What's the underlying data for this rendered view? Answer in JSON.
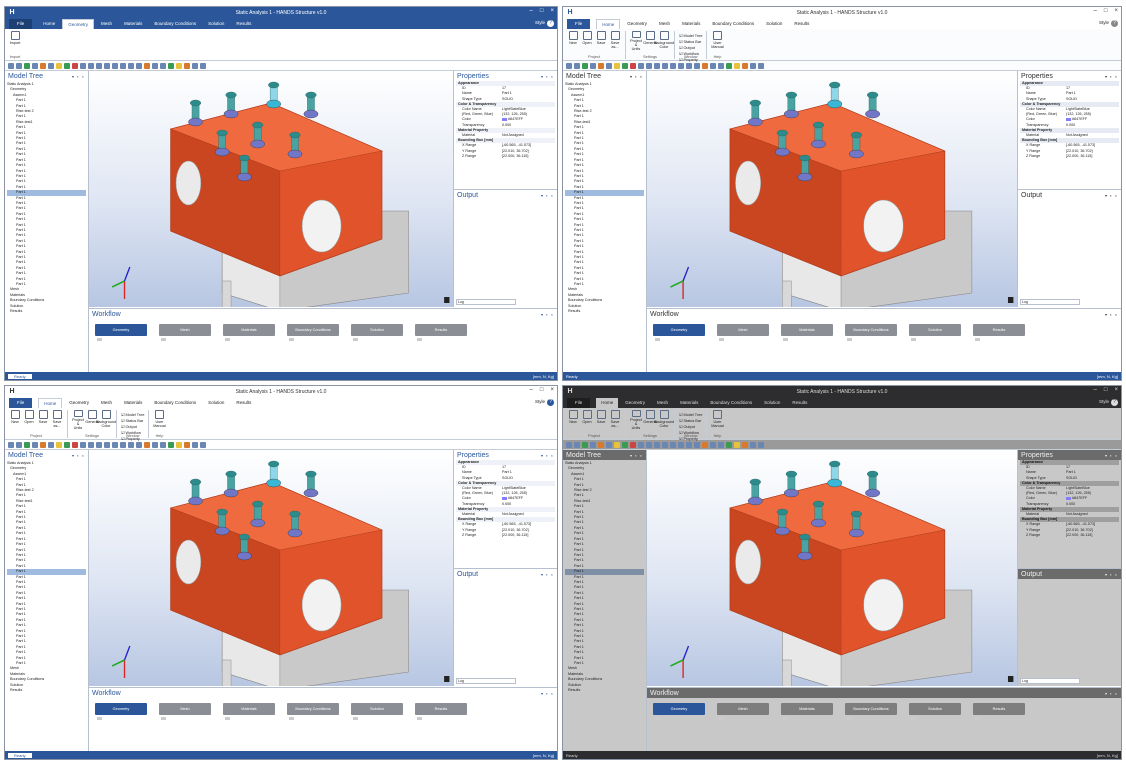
{
  "app": {
    "title": "Static Analysis 1 - HANDS Structure v1.0",
    "ribbon_tabs": [
      "File",
      "Home",
      "Geometry",
      "Mesh",
      "Materials",
      "Boundary Conditions",
      "Solution",
      "Results"
    ],
    "style_label": "Style",
    "help_label": "?",
    "app_icon": "H",
    "window_controls": [
      "–",
      "□",
      "×"
    ]
  },
  "ribbon": {
    "groups": [
      {
        "name": "Project",
        "buttons": [
          "New",
          "Open",
          "Save",
          "Save as..."
        ]
      },
      {
        "name": "Settings",
        "buttons": [
          "Project & Units",
          "General",
          "Background Color"
        ]
      },
      {
        "name": "Window",
        "checks": [
          "Model Tree",
          "Status Bar",
          "Output",
          "Workflow",
          "Property"
        ]
      },
      {
        "name": "Help",
        "buttons": [
          "User Manual"
        ]
      }
    ],
    "geometry_tab_button": "Import",
    "geometry_tab_group": "Import"
  },
  "model_tree": {
    "title": "Model Tree",
    "pane_controls": "▾ ▪ ×",
    "items": [
      {
        "label": "Static Analysis 1",
        "level": 0
      },
      {
        "label": "Geometry",
        "level": 1
      },
      {
        "label": "Assem1",
        "level": 2
      },
      {
        "label": "Part 1",
        "level": 3
      },
      {
        "label": "Part 1",
        "level": 3
      },
      {
        "label": "Rise-test 2",
        "level": 3
      },
      {
        "label": "Part 1",
        "level": 3
      },
      {
        "label": "Rise-test1",
        "level": 3
      },
      {
        "label": "Part 1",
        "level": 3
      },
      {
        "label": "Part 1",
        "level": 3
      },
      {
        "label": "Part 1",
        "level": 3
      },
      {
        "label": "Part 1",
        "level": 3
      },
      {
        "label": "Part 1",
        "level": 3
      },
      {
        "label": "Part 1",
        "level": 3
      },
      {
        "label": "Part 1",
        "level": 3
      },
      {
        "label": "Part 1",
        "level": 3
      },
      {
        "label": "Part 1",
        "level": 3
      },
      {
        "label": "Part 1",
        "level": 3
      },
      {
        "label": "Part 1",
        "level": 3
      },
      {
        "label": "Part 1",
        "level": 3
      },
      {
        "label": "Part 1",
        "level": 3,
        "selected": true
      },
      {
        "label": "Part 1",
        "level": 3
      },
      {
        "label": "Part 1",
        "level": 3
      },
      {
        "label": "Part 1",
        "level": 3
      },
      {
        "label": "Part 1",
        "level": 3
      },
      {
        "label": "Part 1",
        "level": 3
      },
      {
        "label": "Part 1",
        "level": 3
      },
      {
        "label": "Part 1",
        "level": 3
      },
      {
        "label": "Part 1",
        "level": 3
      },
      {
        "label": "Part 1",
        "level": 3
      },
      {
        "label": "Part 1",
        "level": 3
      },
      {
        "label": "Part 1",
        "level": 3
      },
      {
        "label": "Part 1",
        "level": 3
      },
      {
        "label": "Part 1",
        "level": 3
      },
      {
        "label": "Part 1",
        "level": 3
      },
      {
        "label": "Part 1",
        "level": 3
      },
      {
        "label": "Part 1",
        "level": 3
      },
      {
        "label": "Part 1",
        "level": 3
      },
      {
        "label": "Mesh",
        "level": 1
      },
      {
        "label": "Materials",
        "level": 1
      },
      {
        "label": "Boundary Conditions",
        "level": 1
      },
      {
        "label": "Solution",
        "level": 1
      },
      {
        "label": "Results",
        "level": 1
      }
    ]
  },
  "properties": {
    "title": "Properties",
    "pane_controls": "▾ ▪ ×",
    "rows": [
      {
        "cat": "Appearance"
      },
      {
        "k": "ID",
        "v": "17"
      },
      {
        "k": "Name",
        "v": "Part 1"
      },
      {
        "k": "Shape Type",
        "v": "SOLID"
      },
      {
        "cat": "Color & Transparency"
      },
      {
        "k": "Color Name",
        "v": "LightSlateBlue"
      },
      {
        "k": "(Red, Green, Blue)",
        "v": "(132, 126, 255)"
      },
      {
        "k": "Color",
        "v": "#847EFF",
        "swatch": "#847eff"
      },
      {
        "k": "Transparency",
        "v": "0.000"
      },
      {
        "cat": "Material Property"
      },
      {
        "k": "Material",
        "v": "Not Assigned"
      },
      {
        "cat": "Bounding Box [mm]"
      },
      {
        "k": "X Range",
        "v": "[-60.565, -41.573]"
      },
      {
        "k": "Y Range",
        "v": "[22.010, 36.702]"
      },
      {
        "k": "Z Range",
        "v": "[22.000, 36.115]"
      }
    ]
  },
  "output": {
    "title": "Output",
    "pane_controls": "▾ ▪ ×",
    "log_label": "Log"
  },
  "workflow": {
    "title": "Workflow",
    "pane_controls": "▾ ▪ ×",
    "steps": [
      "Geometry",
      "Mesh",
      "Materials",
      "Boundary Conditions",
      "Solution",
      "Results"
    ]
  },
  "status": {
    "ready": "Ready",
    "units": "[mm, N, Kg]"
  },
  "colors": {
    "accent": "#2b579a",
    "part_body": "#e0532b",
    "part_dark": "#b13c1b",
    "base_gray": "#c9c9c9",
    "bolt_teal": "#2e8b8b",
    "nut_blue": "#7276c7",
    "highlight_nut": "#3bb7d6"
  },
  "icons": [
    "view-cube-icon",
    "zoom-icon",
    "pan-icon",
    "rotate-icon",
    "fit-icon"
  ]
}
